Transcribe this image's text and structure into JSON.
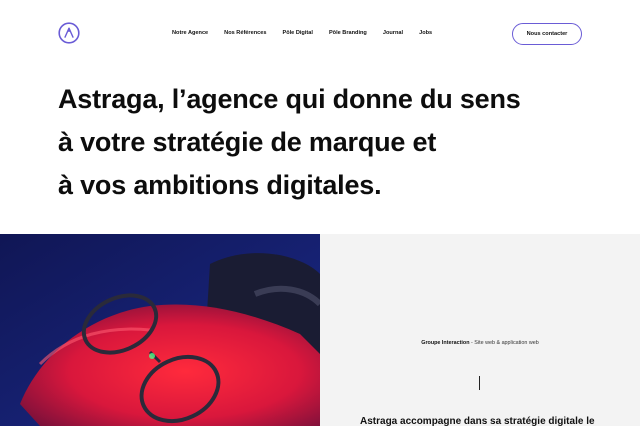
{
  "header": {
    "logo_letter": "A",
    "nav": [
      {
        "label": "Notre Agence"
      },
      {
        "label": "Nos Références"
      },
      {
        "label": "Pôle Digital"
      },
      {
        "label": "Pôle Branding"
      },
      {
        "label": "Journal"
      },
      {
        "label": "Jobs"
      }
    ],
    "cta_label": "Nous contacter"
  },
  "hero": {
    "line1": "Astraga, l’agence qui donne du sens",
    "line2": "à votre stratégie de marque et",
    "line3": "à vos ambitions digitales."
  },
  "project": {
    "client": "Groupe Interaction",
    "separator": " - ",
    "type": "Site web & application web",
    "teaser": "Astraga accompagne dans sa stratégie digitale le"
  },
  "colors": {
    "accent": "#6a5cd6",
    "panel_bg": "#f3f3f3",
    "photo_blue": "#151a66",
    "photo_red": "#e0193f"
  }
}
